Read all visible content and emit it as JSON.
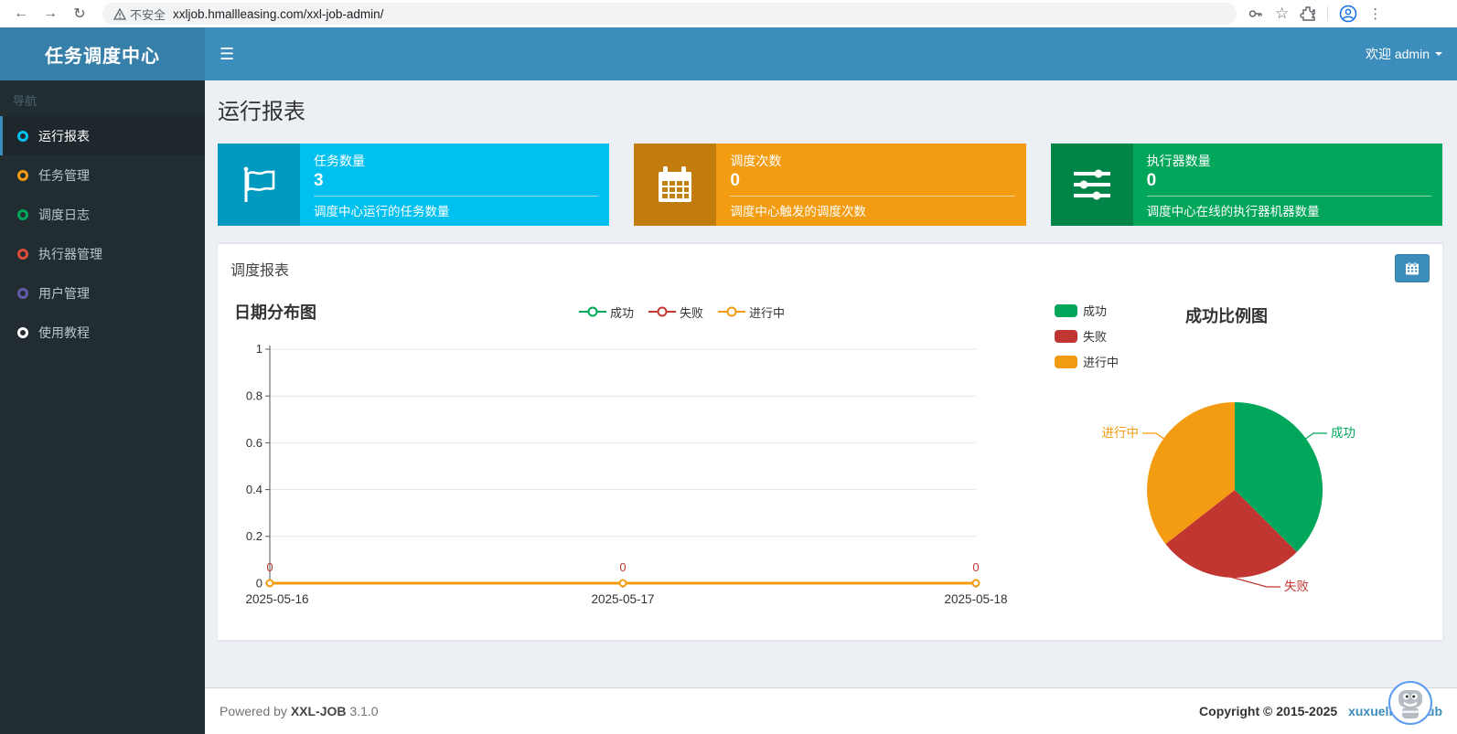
{
  "browser": {
    "security_label": "不安全",
    "url": "xxljob.hmallleasing.com/xxl-job-admin/",
    "icons": [
      "back-arrow",
      "forward-arrow",
      "reload",
      "warning-triangle",
      "key",
      "star",
      "extensions-puzzle",
      "profile-avatar",
      "kebab-menu"
    ]
  },
  "header": {
    "app_title": "任务调度中心",
    "menu_toggle_icon": "hamburger-icon",
    "user_menu": "欢迎 admin"
  },
  "sidebar": {
    "nav_label": "导航",
    "items": [
      {
        "label": "运行报表",
        "icon_color": "#00c0ef",
        "active": true
      },
      {
        "label": "任务管理",
        "icon_color": "#f39c12",
        "active": false
      },
      {
        "label": "调度日志",
        "icon_color": "#00a65a",
        "active": false
      },
      {
        "label": "执行器管理",
        "icon_color": "#dd4b39",
        "active": false
      },
      {
        "label": "用户管理",
        "icon_color": "#605ca8",
        "active": false
      },
      {
        "label": "使用教程",
        "icon_color": "#ffffff",
        "active": false
      }
    ]
  },
  "page": {
    "title": "运行报表"
  },
  "stat_cards": [
    {
      "title": "任务数量",
      "value": "3",
      "desc": "调度中心运行的任务数量",
      "bg": "#00c0ef",
      "icon": "flag-icon"
    },
    {
      "title": "调度次数",
      "value": "0",
      "desc": "调度中心触发的调度次数",
      "bg": "#f39c12",
      "icon": "calendar-icon"
    },
    {
      "title": "执行器数量",
      "value": "0",
      "desc": "调度中心在线的执行器机器数量",
      "bg": "#00a65a",
      "icon": "sliders-icon"
    }
  ],
  "panel": {
    "title": "调度报表",
    "date_button_icon": "calendar-icon",
    "date_button_color": "#3c8dbc"
  },
  "chart_data": [
    {
      "type": "line",
      "title": "日期分布图",
      "x": [
        "2025-05-16",
        "2025-05-17",
        "2025-05-18"
      ],
      "series": [
        {
          "name": "成功",
          "color": "#00a65a",
          "values": [
            0,
            0,
            0
          ]
        },
        {
          "name": "失败",
          "color": "#c23632",
          "values": [
            0,
            0,
            0
          ]
        },
        {
          "name": "进行中",
          "color": "#f39c12",
          "values": [
            0,
            0,
            0
          ]
        }
      ],
      "point_labels": [
        "0",
        "0",
        "0"
      ],
      "ylim": [
        0,
        1
      ],
      "ytick_labels": [
        "1",
        "0.8",
        "0.6",
        "0.4",
        "0.2",
        "0"
      ],
      "grid": true,
      "legend_position": "top-center"
    },
    {
      "type": "pie",
      "title": "成功比例图",
      "slices": [
        {
          "name": "成功",
          "color": "#00a65a",
          "value": 33.3
        },
        {
          "name": "失败",
          "color": "#c23632",
          "value": 33.3
        },
        {
          "name": "进行中",
          "color": "#f39c12",
          "value": 33.3
        }
      ],
      "legend_position": "top-left"
    }
  ],
  "footer": {
    "powered_prefix": "Powered by",
    "brand": "XXL-JOB",
    "version": "3.1.0",
    "copyright": "Copyright © 2015-2025",
    "link_author": "xuxueli",
    "link_repo": "github"
  }
}
